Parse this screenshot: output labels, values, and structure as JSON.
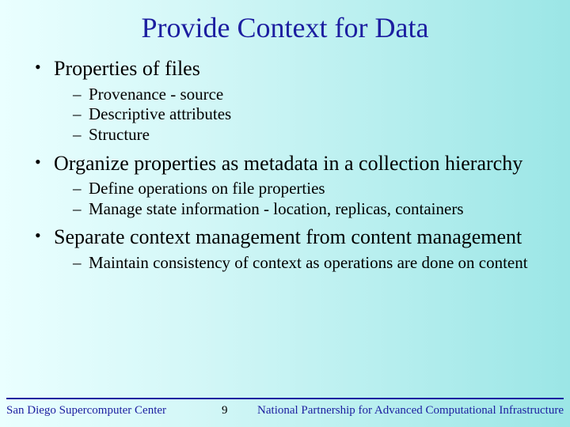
{
  "title": "Provide Context for Data",
  "bullets": [
    {
      "text": "Properties of files",
      "sub": [
        "Provenance - source",
        "Descriptive attributes",
        "Structure"
      ]
    },
    {
      "text": "Organize properties as metadata in a collection hierarchy",
      "sub": [
        "Define operations on file properties",
        "Manage state information - location, replicas, containers"
      ]
    },
    {
      "text": "Separate context management from content management",
      "sub": [
        "Maintain consistency of context as operations are done on content"
      ]
    }
  ],
  "footer": {
    "left": "San Diego Supercomputer Center",
    "page": "9",
    "right": "National Partnership for Advanced Computational Infrastructure"
  }
}
